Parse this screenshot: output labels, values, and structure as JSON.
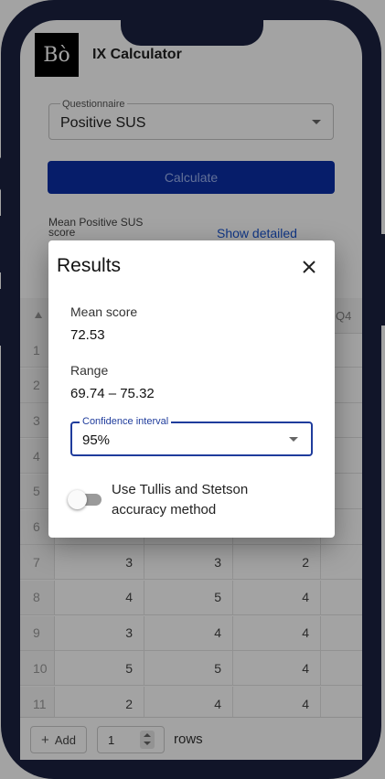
{
  "app": {
    "logo_text": "Bò",
    "title": "IX Calculator"
  },
  "questionnaire": {
    "label": "Questionnaire",
    "value": "Positive SUS"
  },
  "calculate_label": "Calculate",
  "summary": {
    "mean_label": "Mean Positive SUS score",
    "show_detailed": "Show detailed"
  },
  "table": {
    "header_partial": "Q4",
    "rows": [
      {
        "n": "1",
        "cells": []
      },
      {
        "n": "2",
        "cells": []
      },
      {
        "n": "3",
        "cells": []
      },
      {
        "n": "4",
        "cells": []
      },
      {
        "n": "5",
        "cells": []
      },
      {
        "n": "6",
        "cells": []
      },
      {
        "n": "7",
        "cells": [
          "3",
          "3",
          "2"
        ]
      },
      {
        "n": "8",
        "cells": [
          "4",
          "5",
          "4"
        ]
      },
      {
        "n": "9",
        "cells": [
          "3",
          "4",
          "4"
        ]
      },
      {
        "n": "10",
        "cells": [
          "5",
          "5",
          "4"
        ]
      },
      {
        "n": "11",
        "cells": [
          "2",
          "4",
          "4"
        ]
      }
    ]
  },
  "bottom": {
    "add_label": "Add",
    "rows_value": "1",
    "rows_label": "rows"
  },
  "dialog": {
    "title": "Results",
    "mean_label": "Mean score",
    "mean_value": "72.53",
    "range_label": "Range",
    "range_value": "69.74 – 75.32",
    "ci_label": "Confidence interval",
    "ci_value": "95%",
    "toggle_label": "Use Tullis and Stetson accuracy method",
    "toggle_on": false
  },
  "colors": {
    "frame": "#1b2240",
    "primary": "#0a2ea6",
    "ci_border": "#1f3c9c"
  }
}
